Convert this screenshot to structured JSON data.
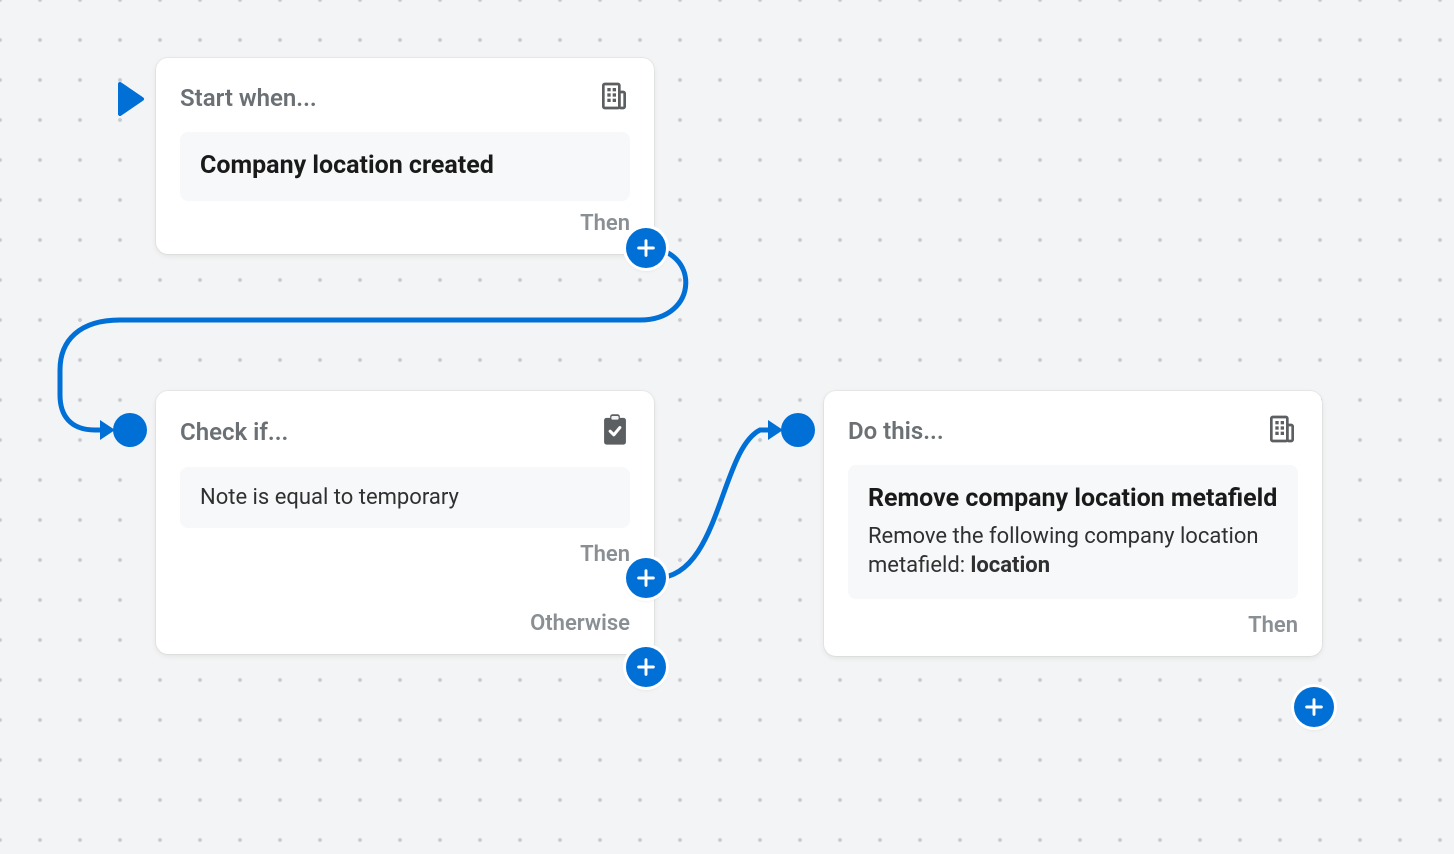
{
  "labels": {
    "then": "Then",
    "otherwise": "Otherwise"
  },
  "icons": {
    "play": "play-icon",
    "building": "building-icon",
    "clipboard": "clipboard-check-icon",
    "plus": "plus-icon"
  },
  "nodes": {
    "trigger": {
      "header": "Start when...",
      "title": "Company location created"
    },
    "condition": {
      "header": "Check if...",
      "text": "Note is equal to temporary"
    },
    "action": {
      "header": "Do this...",
      "title": "Remove company location metafield",
      "description_pre": "Remove the following company location metafield: ",
      "description_bold": "location"
    }
  }
}
